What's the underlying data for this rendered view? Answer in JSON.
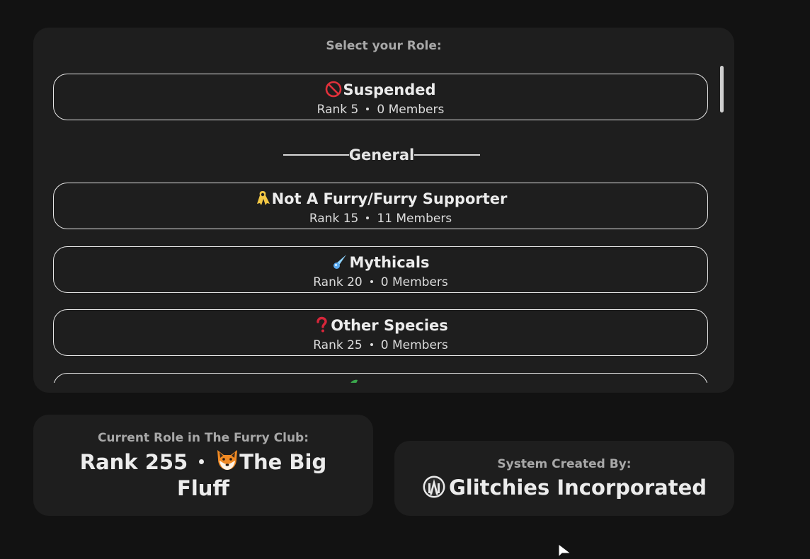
{
  "role_selector": {
    "heading": "Select your Role:",
    "roles": [
      {
        "name": "Suspended",
        "rank": "Rank 5",
        "members": "0 Members",
        "icon": "no-entry-icon"
      },
      {
        "name": "Not A Furry/Furry Supporter",
        "rank": "Rank 15",
        "members": "11 Members",
        "icon": "ribbon-icon"
      },
      {
        "name": "Mythicals",
        "rank": "Rank 20",
        "members": "0 Members",
        "icon": "comet-icon"
      },
      {
        "name": "Other Species",
        "rank": "Rank 25",
        "members": "0 Members",
        "icon": "question-mark-icon"
      }
    ],
    "section_divider": "General"
  },
  "current_role": {
    "heading": "Current Role in The Furry Club:",
    "rank": "Rank 255",
    "role_name": "The Big",
    "role_name_2": "Fluff",
    "icon": "fox-face-icon"
  },
  "credits": {
    "heading": "System Created By:",
    "creator": "Glitchies Incorporated",
    "icon": "glitchies-logo-icon"
  },
  "colors": {
    "background": "#121212",
    "panel": "#1e1e1e",
    "card_border": "#e6e6e6",
    "muted_text": "#a8a8a8"
  }
}
